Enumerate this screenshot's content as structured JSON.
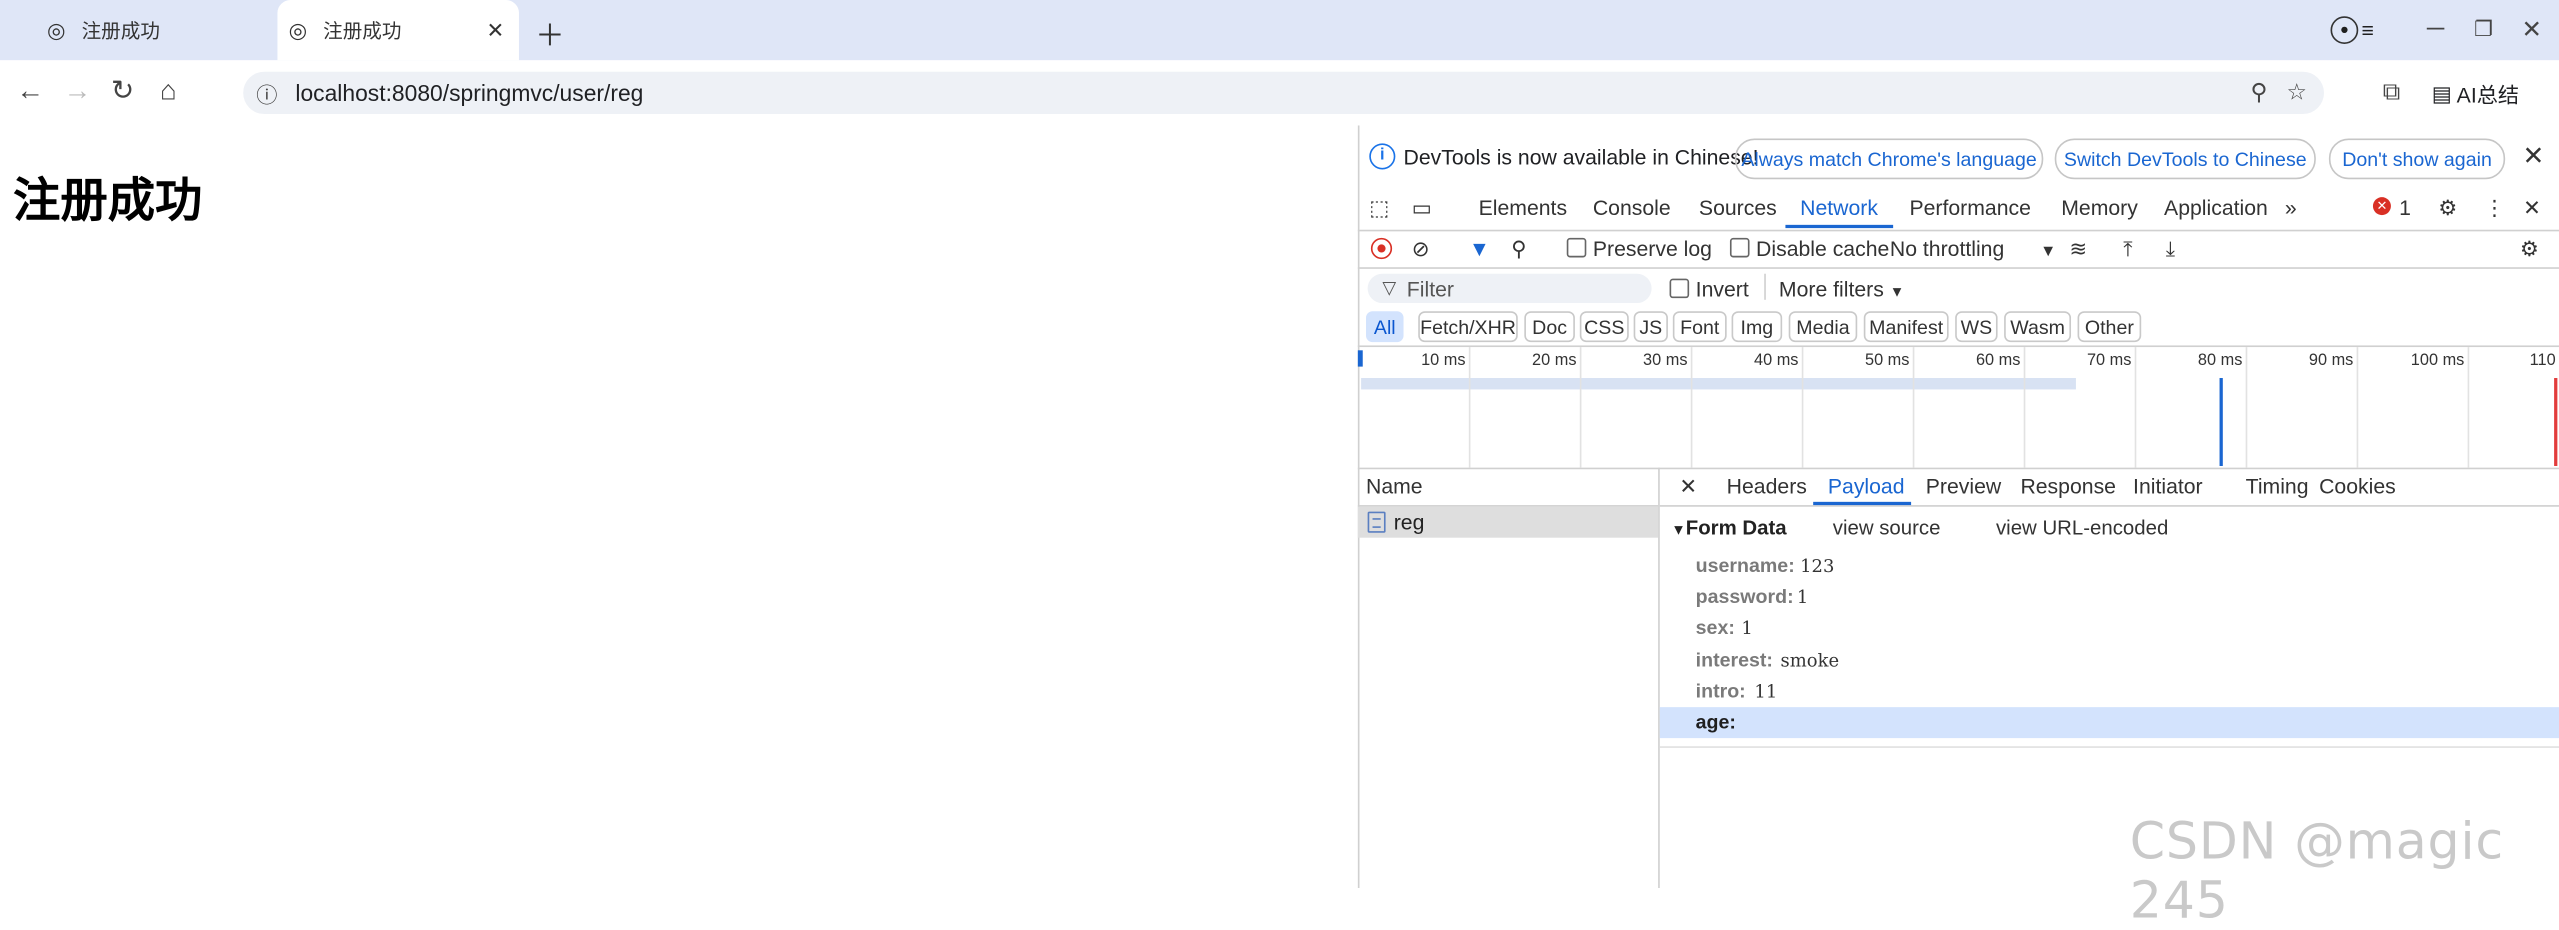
{
  "browser": {
    "tabs": [
      {
        "title": "注册成功",
        "active": false
      },
      {
        "title": "注册成功",
        "active": true
      }
    ],
    "url": "localhost:8080/springmvc/user/reg",
    "ai_label": "AI总结"
  },
  "page": {
    "heading": "注册成功"
  },
  "devtools": {
    "infobar": {
      "message": "DevTools is now available in Chinese!",
      "btn_match": "Always match Chrome's language",
      "btn_switch": "Switch DevTools to Chinese",
      "btn_dont": "Don't show again"
    },
    "tabs": [
      "Elements",
      "Console",
      "Sources",
      "Network",
      "Performance",
      "Memory",
      "Application"
    ],
    "active_tab": "Network",
    "error_count": "1",
    "network": {
      "preserve_log": "Preserve log",
      "disable_cache": "Disable cache",
      "throttling": "No throttling",
      "filter_placeholder": "Filter",
      "invert": "Invert",
      "more_filters": "More filters",
      "type_filters": [
        "All",
        "Fetch/XHR",
        "Doc",
        "CSS",
        "JS",
        "Font",
        "Img",
        "Media",
        "Manifest",
        "WS",
        "Wasm",
        "Other"
      ],
      "timeline_ticks": [
        "10 ms",
        "20 ms",
        "30 ms",
        "40 ms",
        "50 ms",
        "60 ms",
        "70 ms",
        "80 ms",
        "90 ms",
        "100 ms",
        "110"
      ],
      "name_header": "Name",
      "requests": [
        "reg"
      ]
    },
    "detail": {
      "tabs": [
        "Headers",
        "Payload",
        "Preview",
        "Response",
        "Initiator",
        "Timing",
        "Cookies"
      ],
      "active_tab": "Payload",
      "form_data_title": "Form Data",
      "view_source": "view source",
      "view_url_encoded": "view URL-encoded",
      "fields": [
        {
          "key": "username:",
          "value": "123"
        },
        {
          "key": "password:",
          "value": "1"
        },
        {
          "key": "sex:",
          "value": "1"
        },
        {
          "key": "interest:",
          "value": "smoke"
        },
        {
          "key": "intro:",
          "value": "11"
        },
        {
          "key": "age:",
          "value": ""
        }
      ]
    }
  },
  "watermark": "CSDN @magic 245"
}
